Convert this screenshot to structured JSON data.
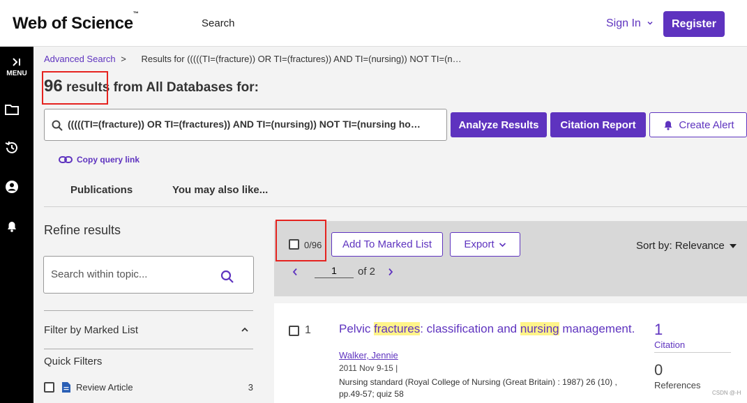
{
  "header": {
    "logo": "Web of Science",
    "logo_tm": "™",
    "nav_search": "Search",
    "sign_in": "Sign In",
    "register": "Register"
  },
  "sidebar": {
    "menu_label": "MENU"
  },
  "breadcrumb": {
    "advanced": "Advanced Search",
    "separator": ">",
    "current": "Results for (((((TI=(fracture)) OR TI=(fractures)) AND TI=(nursing)) NOT TI=(n…"
  },
  "results": {
    "count": "96",
    "results_word": "results",
    "suffix": "from All Databases for:"
  },
  "query": {
    "text": "(((((TI=(fracture)) OR TI=(fractures)) AND TI=(nursing)) NOT TI=(nursing home)))",
    "analyze": "Analyze Results",
    "citation_report": "Citation Report",
    "create_alert": "Create Alert",
    "copy_link": "Copy query link"
  },
  "tabs": [
    {
      "label": "Publications"
    },
    {
      "label": "You may also like..."
    }
  ],
  "refine": {
    "title": "Refine results",
    "search_placeholder": "Search within topic...",
    "filter_marked": "Filter by Marked List",
    "quick_filters": "Quick Filters",
    "quick_items": [
      {
        "label": "Review Article",
        "count": "3"
      }
    ]
  },
  "toolbar": {
    "selected": "0/96",
    "add_marked": "Add To Marked List",
    "export": "Export",
    "sort_by": "Sort by: Relevance",
    "page_current": "1",
    "page_of": "of 2"
  },
  "records": [
    {
      "number": "1",
      "title_parts": [
        "Pelvic ",
        "fractures",
        ": classification and ",
        "nursing",
        " management."
      ],
      "author": "Walker, Jennie",
      "date": "2011 Nov 9-15 |",
      "source": "Nursing standard (Royal College of Nursing (Great Britain) : 1987) 26 (10) , pp.49-57; quiz 58",
      "citations": "1",
      "citations_label": "Citation",
      "references": "0",
      "references_label": "References"
    }
  ],
  "watermark": "CSDN @-H",
  "colors": {
    "brand": "#5e33bf",
    "highlight": "#fff48a",
    "annotation": "#e5231f"
  }
}
